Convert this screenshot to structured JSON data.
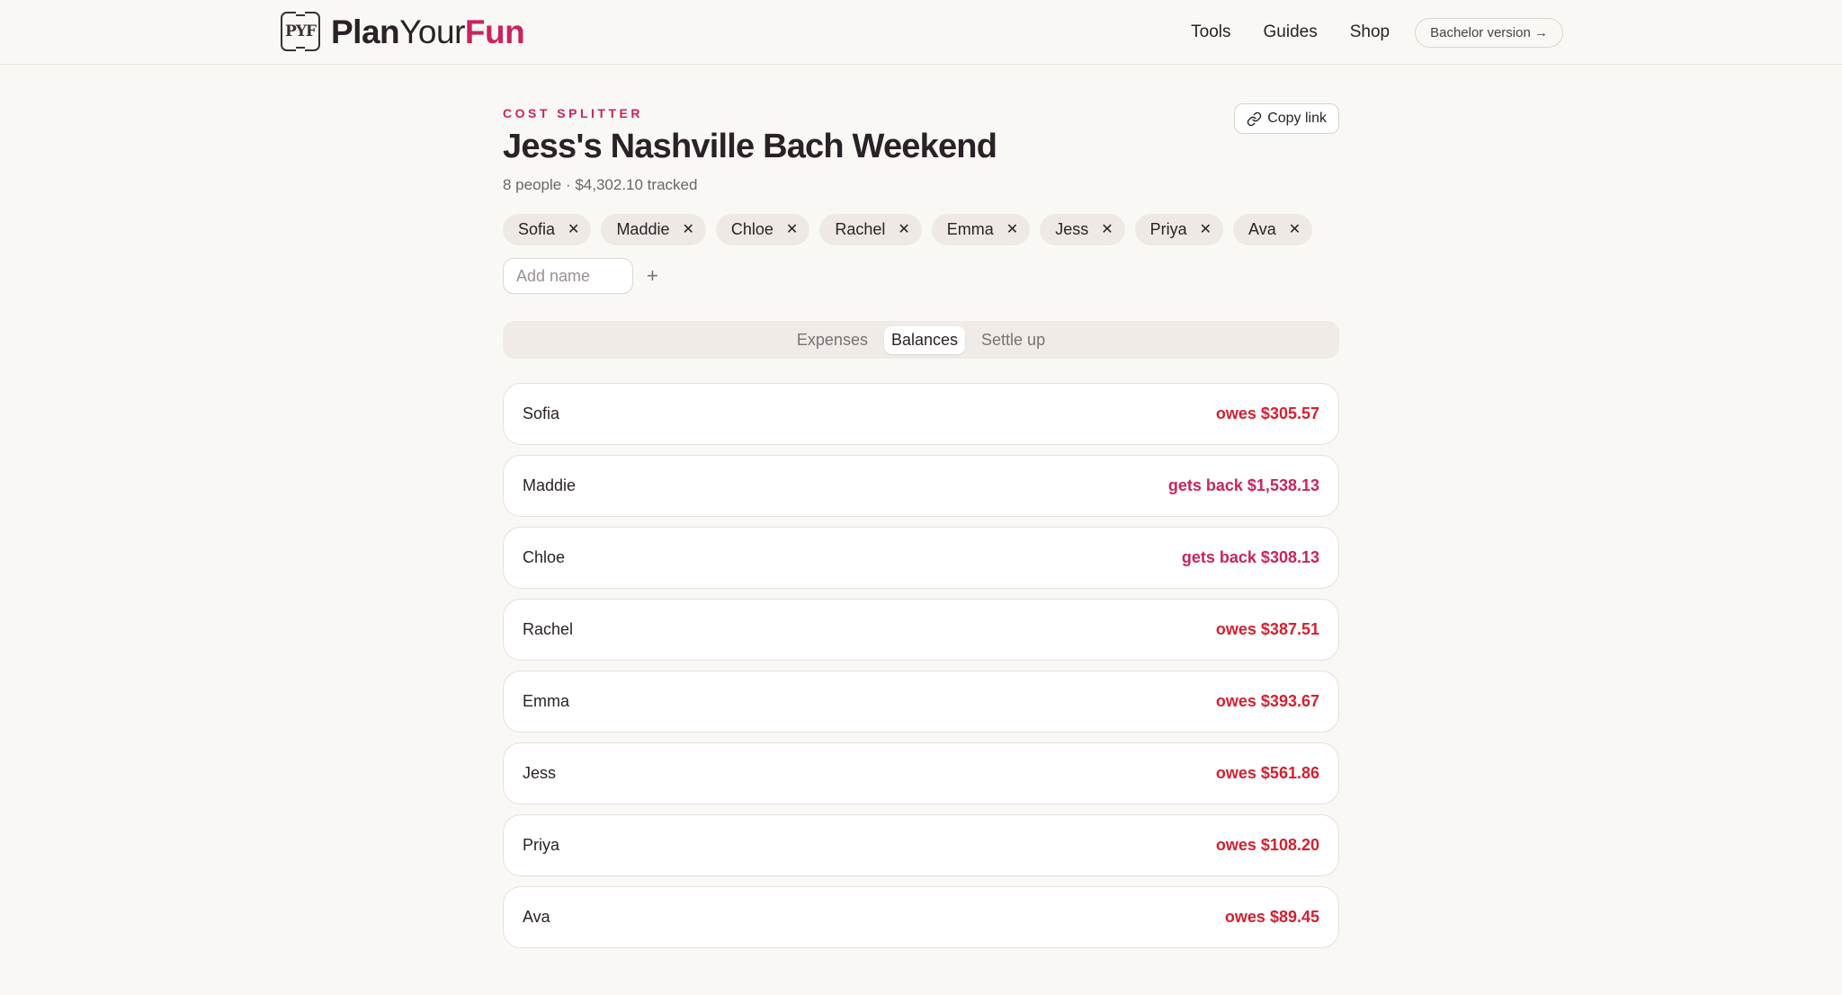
{
  "brand": {
    "logo_mark": "PYF",
    "name_part1": "Plan",
    "name_part2": "Your",
    "name_part3": "Fun"
  },
  "nav": {
    "links": [
      "Tools",
      "Guides",
      "Shop"
    ],
    "pill_label": "Bachelor version →"
  },
  "header": {
    "eyebrow": "COST SPLITTER",
    "title": "Jess's Nashville Bach Weekend",
    "subtitle": "8 people · $4,302.10 tracked",
    "copy_link_label": "Copy link"
  },
  "people": [
    "Sofia",
    "Maddie",
    "Chloe",
    "Rachel",
    "Emma",
    "Jess",
    "Priya",
    "Ava"
  ],
  "add_name": {
    "placeholder": "Add name",
    "button": "+"
  },
  "tabs": [
    {
      "label": "Expenses",
      "active": false
    },
    {
      "label": "Balances",
      "active": true
    },
    {
      "label": "Settle up",
      "active": false
    }
  ],
  "balances": [
    {
      "name": "Sofia",
      "text": "owes $305.57",
      "status": "owes"
    },
    {
      "name": "Maddie",
      "text": "gets back $1,538.13",
      "status": "gets"
    },
    {
      "name": "Chloe",
      "text": "gets back $308.13",
      "status": "gets"
    },
    {
      "name": "Rachel",
      "text": "owes $387.51",
      "status": "owes"
    },
    {
      "name": "Emma",
      "text": "owes $393.67",
      "status": "owes"
    },
    {
      "name": "Jess",
      "text": "owes $561.86",
      "status": "owes"
    },
    {
      "name": "Priya",
      "text": "owes $108.20",
      "status": "owes"
    },
    {
      "name": "Ava",
      "text": "owes $89.45",
      "status": "owes"
    }
  ],
  "icons": {
    "link": "link-icon",
    "remove": "close-icon",
    "add": "plus-icon"
  },
  "colors": {
    "accent": "#c8245f",
    "owes": "#d42030",
    "background": "#faf8f5"
  }
}
